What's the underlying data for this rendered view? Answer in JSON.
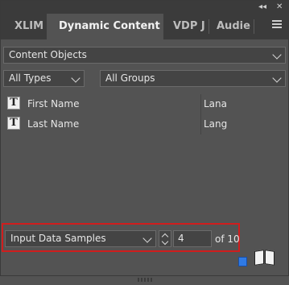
{
  "tabs": [
    {
      "label": "XLIM"
    },
    {
      "label": "Dynamic Content"
    },
    {
      "label": "VDP J"
    },
    {
      "label": "Audie"
    }
  ],
  "content_selector": {
    "value": "Content Objects"
  },
  "type_filter": {
    "value": "All Types"
  },
  "group_filter": {
    "value": "All Groups"
  },
  "rows": [
    {
      "name": "First Name",
      "value": "Lana"
    },
    {
      "name": "Last Name",
      "value": "Lang"
    }
  ],
  "data_samples": {
    "source": "Input Data Samples",
    "current": "4",
    "of_text": "of 10"
  },
  "colors": {
    "panel_bg": "#535353",
    "highlight_border": "#d01d1d",
    "accent_blue": "#2f7ae5"
  }
}
